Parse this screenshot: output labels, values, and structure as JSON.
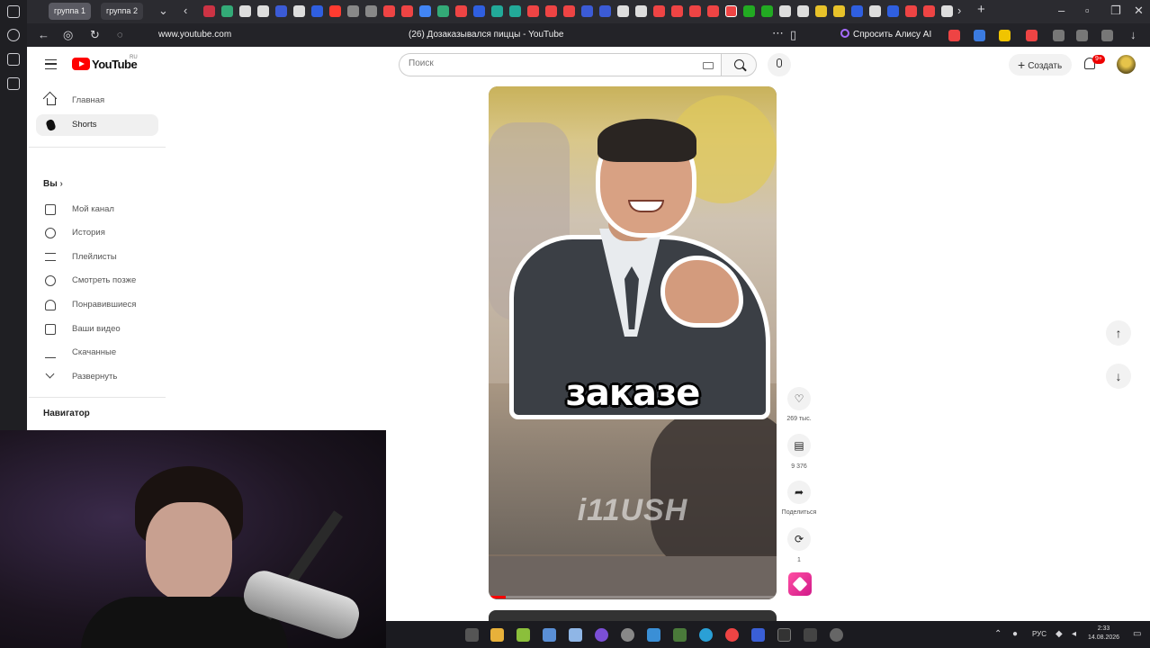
{
  "browser": {
    "tabs": [
      {
        "label": "группа 1"
      },
      {
        "label": "группа 2"
      }
    ],
    "url": "www.youtube.com",
    "page_title": "(26) Дозаказывался пиццы - YouTube",
    "alice_label": "Спросить Алису AI"
  },
  "header": {
    "logo_text": "YouTube",
    "region": "RU",
    "search_placeholder": "Поиск",
    "create_label": "Создать",
    "notification_count": "9+"
  },
  "sidebar": {
    "main": [
      {
        "label": "Главная",
        "icon": "home-icon"
      },
      {
        "label": "Shorts",
        "icon": "shorts-icon",
        "active": true
      }
    ],
    "you_title": "Вы",
    "you_items": [
      {
        "label": "Мой канал",
        "icon": "channel-icon"
      },
      {
        "label": "История",
        "icon": "history-icon"
      },
      {
        "label": "Плейлисты",
        "icon": "playlists-icon"
      },
      {
        "label": "Смотреть позже",
        "icon": "watch-later-icon"
      },
      {
        "label": "Понравившиеся",
        "icon": "like-icon"
      },
      {
        "label": "Ваши видео",
        "icon": "your-videos-icon"
      },
      {
        "label": "Скачанные",
        "icon": "downloads-icon"
      },
      {
        "label": "Развернуть",
        "icon": "expand-icon"
      }
    ],
    "navigator_title": "Навигатор"
  },
  "short": {
    "caption": "заказе",
    "watermark": "i11USH",
    "progress": 0.06
  },
  "actions": {
    "likes": "269 тыс.",
    "comments": "9 376",
    "share": "Поделиться",
    "remix": "1"
  },
  "taskbar": {
    "lang": "РУС",
    "time": "2:33",
    "date": "14.08.2026"
  },
  "colors": {
    "brand": "#ff0000",
    "chrome": "#2b2b30"
  }
}
